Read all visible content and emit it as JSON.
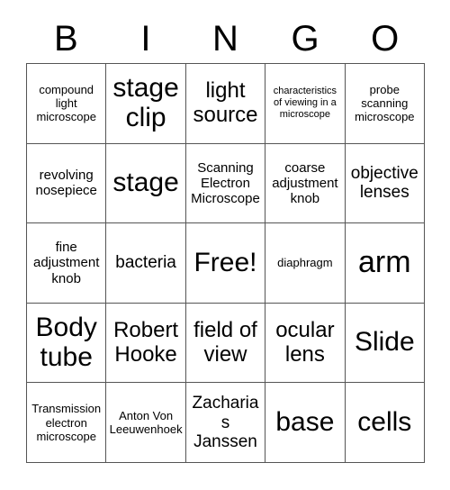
{
  "card": {
    "title_letters": [
      "B",
      "I",
      "N",
      "G",
      "O"
    ],
    "columns": 5,
    "rows": 5,
    "border_color": "#555555",
    "background_color": "#ffffff",
    "text_color": "#000000",
    "cells": [
      [
        {
          "text": "compound light microscope",
          "size": "fs-s"
        },
        {
          "text": "stage clip",
          "size": "fs-xxl"
        },
        {
          "text": "light source",
          "size": "fs-xl"
        },
        {
          "text": "characteristics of viewing in a microscope",
          "size": "fs-xs"
        },
        {
          "text": "probe scanning microscope",
          "size": "fs-s"
        }
      ],
      [
        {
          "text": "revolving nosepiece",
          "size": "fs-m"
        },
        {
          "text": "stage",
          "size": "fs-xxl"
        },
        {
          "text": "Scanning Electron Microscope",
          "size": "fs-m"
        },
        {
          "text": "coarse adjustment knob",
          "size": "fs-m"
        },
        {
          "text": "objective lenses",
          "size": "fs-l"
        }
      ],
      [
        {
          "text": "fine adjustment knob",
          "size": "fs-m"
        },
        {
          "text": "bacteria",
          "size": "fs-l"
        },
        {
          "text": "Free!",
          "size": "fs-xxl"
        },
        {
          "text": "diaphragm",
          "size": "fs-s"
        },
        {
          "text": "arm",
          "size": "fs-huge"
        }
      ],
      [
        {
          "text": "Body tube",
          "size": "fs-xxl"
        },
        {
          "text": "Robert Hooke",
          "size": "fs-xl"
        },
        {
          "text": "field of view",
          "size": "fs-xl"
        },
        {
          "text": "ocular lens",
          "size": "fs-xl"
        },
        {
          "text": "Slide",
          "size": "fs-xxl"
        }
      ],
      [
        {
          "text": "Transmission electron microscope",
          "size": "fs-s"
        },
        {
          "text": "Anton Von Leeuwenhoek",
          "size": "fs-s"
        },
        {
          "text": "Zacharias Janssen",
          "size": "fs-l"
        },
        {
          "text": "base",
          "size": "fs-xxl"
        },
        {
          "text": "cells",
          "size": "fs-xxl"
        }
      ]
    ]
  }
}
